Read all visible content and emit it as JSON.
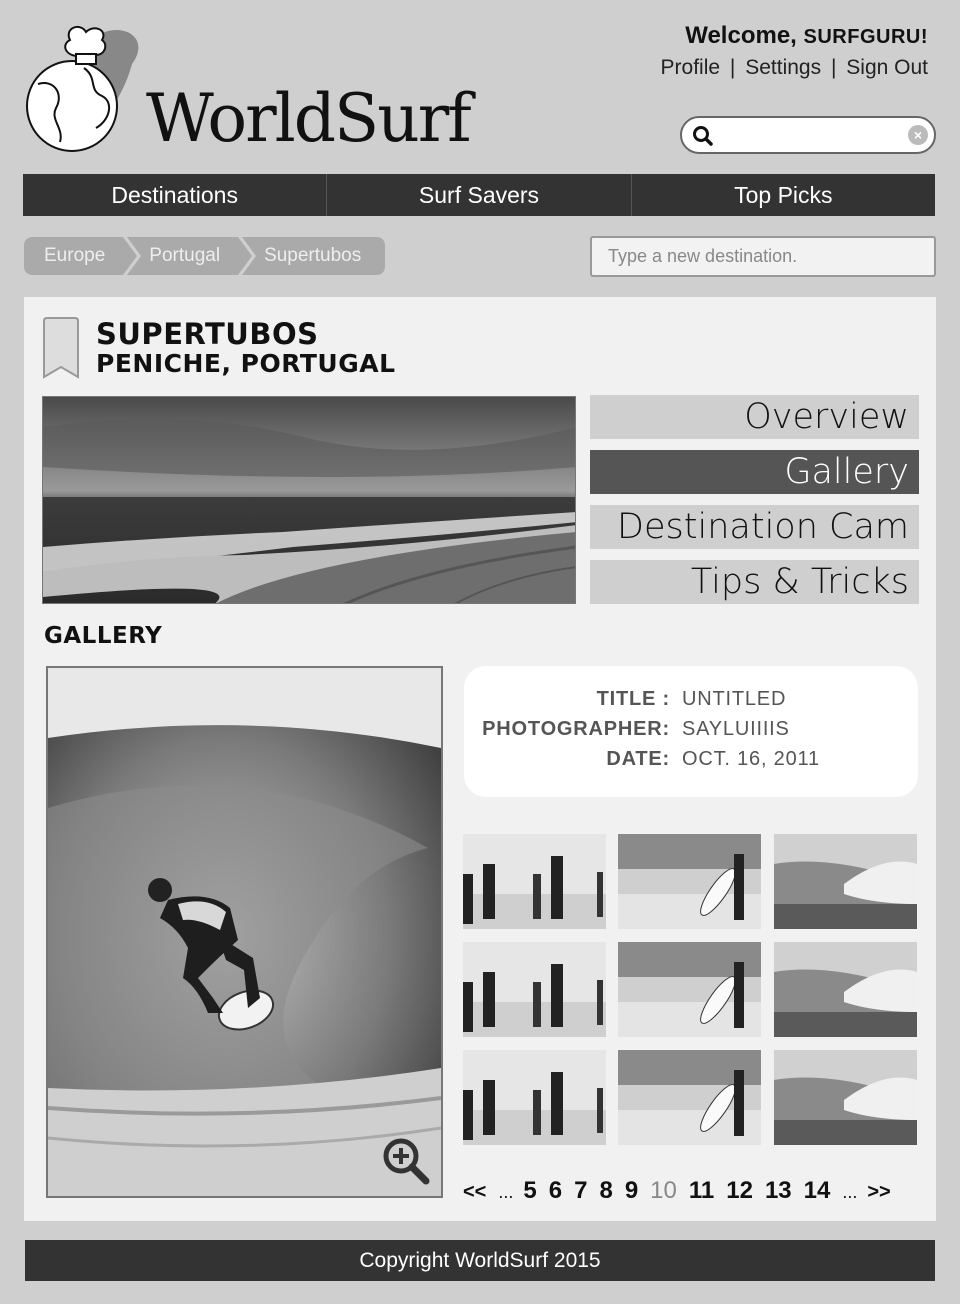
{
  "brand": {
    "name": "WorldSurf"
  },
  "user": {
    "greeting": "Welcome, ",
    "username": "SURFGURU!",
    "links": [
      "Profile",
      "Settings",
      "Sign Out"
    ],
    "separator": "|"
  },
  "search": {
    "placeholder": ""
  },
  "nav": {
    "items": [
      "Destinations",
      "Surf Savers",
      "Top Picks"
    ]
  },
  "breadcrumb": {
    "items": [
      "Europe",
      "Portugal",
      "Supertubos"
    ]
  },
  "destination_input": {
    "placeholder": "Type a new destination."
  },
  "spot": {
    "title": "SUPERTUBOS",
    "subtitle": "PENICHE, PORTUGAL"
  },
  "tabs": [
    {
      "label": "Overview",
      "active": false
    },
    {
      "label": "Gallery",
      "active": true
    },
    {
      "label": "Destination Cam",
      "active": false
    },
    {
      "label": "Tips & Tricks",
      "active": false
    }
  ],
  "gallery": {
    "heading": "GALLERY",
    "info": [
      {
        "key": "TITLE :",
        "value": "UNTITLED"
      },
      {
        "key": "PHOTOGRAPHER:",
        "value": "SAYLUIIIIS"
      },
      {
        "key": "DATE:",
        "value": "OCT. 16, 2011"
      }
    ],
    "pager": {
      "prev": "<<",
      "ellipsis": "...",
      "pages": [
        "5",
        "6",
        "7",
        "8",
        "9",
        "10",
        "11",
        "12",
        "13",
        "14"
      ],
      "current": "10",
      "next": ">>"
    }
  },
  "footer": {
    "text": "Copyright WorldSurf 2015"
  },
  "colors": {
    "nav_bg": "#333333",
    "tab_active": "#555555",
    "panel_bg": "#f1f1f1",
    "page_bg": "#cfcfcf"
  }
}
